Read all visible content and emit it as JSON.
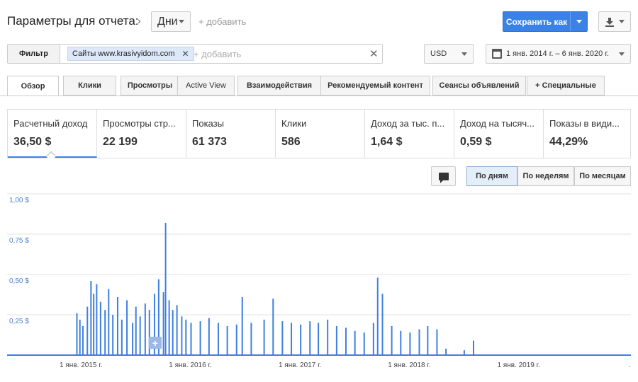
{
  "header": {
    "title": "Параметры для отчета:",
    "separator": "›",
    "dimension": "Дни",
    "add_label": "+ добавить",
    "save_label": "Сохранить как"
  },
  "filter": {
    "label": "Фильтр",
    "chip": "Сайты www.krasivyidom.com",
    "chip_remove": "✕",
    "add_placeholder": "+ добавить",
    "clear": "✕"
  },
  "currency": "USD",
  "date_range": "1 янв. 2014 г. – 6 янв. 2020 г.",
  "tabs": [
    {
      "label": "Обзор",
      "active": true
    },
    {
      "label": "Клики"
    },
    {
      "label": "Просмотры"
    },
    {
      "label": "Active View"
    },
    {
      "label": "Взаимодействия"
    },
    {
      "label": "Рекомендуемый контент"
    },
    {
      "label": "Сеансы объявлений"
    },
    {
      "label": "+ Специальные"
    }
  ],
  "metrics": [
    {
      "name": "Расчетный доход",
      "value": "36,50 $"
    },
    {
      "name": "Просмотры стр...",
      "value": "22 199"
    },
    {
      "name": "Показы",
      "value": "61 373"
    },
    {
      "name": "Клики",
      "value": "586"
    },
    {
      "name": "Доход за тыс. п...",
      "value": "1,64 $"
    },
    {
      "name": "Доход на тысяч...",
      "value": "0,59 $"
    },
    {
      "name": "Показы в види...",
      "value": "44,29%"
    }
  ],
  "granularity": [
    "По дням",
    "По неделям",
    "По месяцам"
  ],
  "granularity_selected": "По дням",
  "colors": {
    "accent": "#3b82e6",
    "series": "#3f7fe0"
  },
  "chart_data": {
    "type": "bar",
    "ylim": [
      0,
      1.0
    ],
    "y_ticks": [
      "1,00 $",
      "0,75 $",
      "0,50 $",
      "0,25 $"
    ],
    "x_ticks": [
      "1 янв. 2015 г.",
      "1 янв. 2016 г.",
      "1 янв. 2017 г.",
      "1 янв. 2018 г.",
      "1 янв. 2019 г.",
      "."
    ],
    "grid": true,
    "series": [
      {
        "values_sparse": [
          [
            "2014-12-16",
            0.26
          ],
          [
            "2014-12-26",
            0.22
          ],
          [
            "2015-01-05",
            0.18
          ],
          [
            "2015-01-20",
            0.3
          ],
          [
            "2015-02-01",
            0.46
          ],
          [
            "2015-02-10",
            0.38
          ],
          [
            "2015-02-20",
            0.44
          ],
          [
            "2015-03-05",
            0.33
          ],
          [
            "2015-03-20",
            0.28
          ],
          [
            "2015-04-01",
            0.41
          ],
          [
            "2015-04-15",
            0.25
          ],
          [
            "2015-05-01",
            0.36
          ],
          [
            "2015-05-15",
            0.22
          ],
          [
            "2015-06-01",
            0.34
          ],
          [
            "2015-06-20",
            0.2
          ],
          [
            "2015-07-01",
            0.3
          ],
          [
            "2015-07-15",
            0.24
          ],
          [
            "2015-08-01",
            0.32
          ],
          [
            "2015-08-15",
            0.28
          ],
          [
            "2015-09-01",
            0.38
          ],
          [
            "2015-09-15",
            0.47
          ],
          [
            "2015-10-01",
            0.39
          ],
          [
            "2015-10-08",
            0.82
          ],
          [
            "2015-10-20",
            0.34
          ],
          [
            "2015-11-01",
            0.28
          ],
          [
            "2015-11-15",
            0.31
          ],
          [
            "2015-12-01",
            0.24
          ],
          [
            "2015-12-15",
            0.22
          ],
          [
            "2016-01-01",
            0.2
          ],
          [
            "2016-02-01",
            0.21
          ],
          [
            "2016-03-01",
            0.23
          ],
          [
            "2016-04-01",
            0.2
          ],
          [
            "2016-05-01",
            0.18
          ],
          [
            "2016-06-01",
            0.19
          ],
          [
            "2016-06-20",
            0.36
          ],
          [
            "2016-07-20",
            0.2
          ],
          [
            "2016-09-01",
            0.22
          ],
          [
            "2016-10-01",
            0.35
          ],
          [
            "2016-11-01",
            0.21
          ],
          [
            "2016-12-01",
            0.2
          ],
          [
            "2017-01-01",
            0.19
          ],
          [
            "2017-02-01",
            0.21
          ],
          [
            "2017-03-01",
            0.2
          ],
          [
            "2017-04-01",
            0.22
          ],
          [
            "2017-05-01",
            0.18
          ],
          [
            "2017-06-01",
            0.17
          ],
          [
            "2017-07-01",
            0.15
          ],
          [
            "2017-08-01",
            0.14
          ],
          [
            "2017-09-01",
            0.2
          ],
          [
            "2017-09-15",
            0.48
          ],
          [
            "2017-10-01",
            0.38
          ],
          [
            "2017-11-01",
            0.18
          ],
          [
            "2017-12-01",
            0.15
          ],
          [
            "2018-01-01",
            0.14
          ],
          [
            "2018-02-01",
            0.16
          ],
          [
            "2018-03-01",
            0.18
          ],
          [
            "2018-04-01",
            0.16
          ],
          [
            "2018-05-01",
            0.04
          ],
          [
            "2018-07-01",
            0.03
          ],
          [
            "2018-08-01",
            0.09
          ]
        ]
      }
    ]
  }
}
